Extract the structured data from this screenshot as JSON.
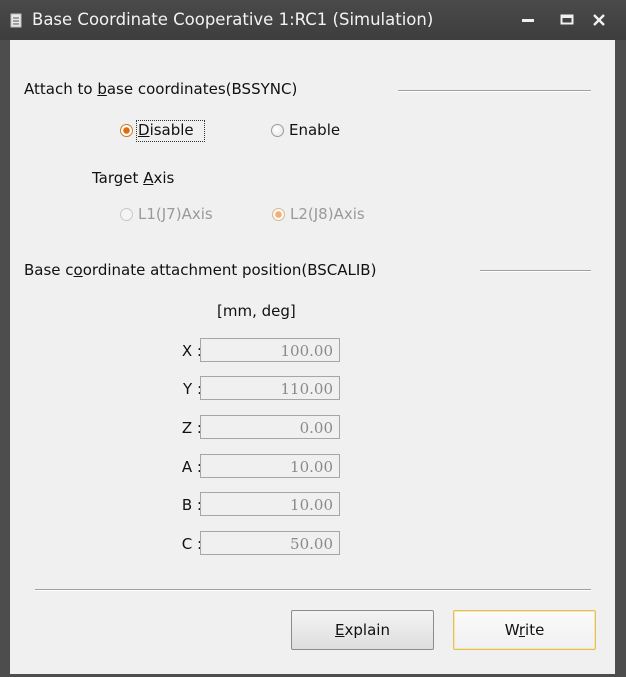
{
  "window": {
    "title": "Base Coordinate Cooperative 1:RC1 (Simulation)",
    "controls": {
      "minimize": "minimize-icon",
      "maximize": "maximize-icon",
      "close": "close-icon"
    }
  },
  "attach": {
    "heading_pre": "Attach to ",
    "heading_accel": "b",
    "heading_post": "ase coordinates(BSSYNC)",
    "disable_accel": "D",
    "disable_rest": "isable",
    "enable_label": "Enable",
    "selected": "Disable"
  },
  "target_axis": {
    "label_pre": "Target ",
    "label_accel": "A",
    "label_post": "xis",
    "option1": "L1(J7)Axis",
    "option2": "L2(J8)Axis",
    "selected": "L2(J8)Axis"
  },
  "position": {
    "heading_pre": "Base c",
    "heading_accel": "o",
    "heading_post": "ordinate attachment position(BSCALIB)",
    "units": "[mm, deg]",
    "fields": [
      {
        "label": "X :",
        "value": "100.00"
      },
      {
        "label": "Y :",
        "value": "110.00"
      },
      {
        "label": "Z :",
        "value": "0.00"
      },
      {
        "label": "A :",
        "value": "10.00"
      },
      {
        "label": "B :",
        "value": "10.00"
      },
      {
        "label": "C :",
        "value": "50.00"
      }
    ]
  },
  "buttons": {
    "explain_accel": "E",
    "explain_rest": "xplain",
    "write_pre": "W",
    "write_accel": "r",
    "write_post": "ite"
  },
  "colors": {
    "titlebar": "#3d3d3d",
    "client": "#f0f0f0",
    "radio_checked": "#e06a10",
    "write_border": "#e0c060"
  }
}
